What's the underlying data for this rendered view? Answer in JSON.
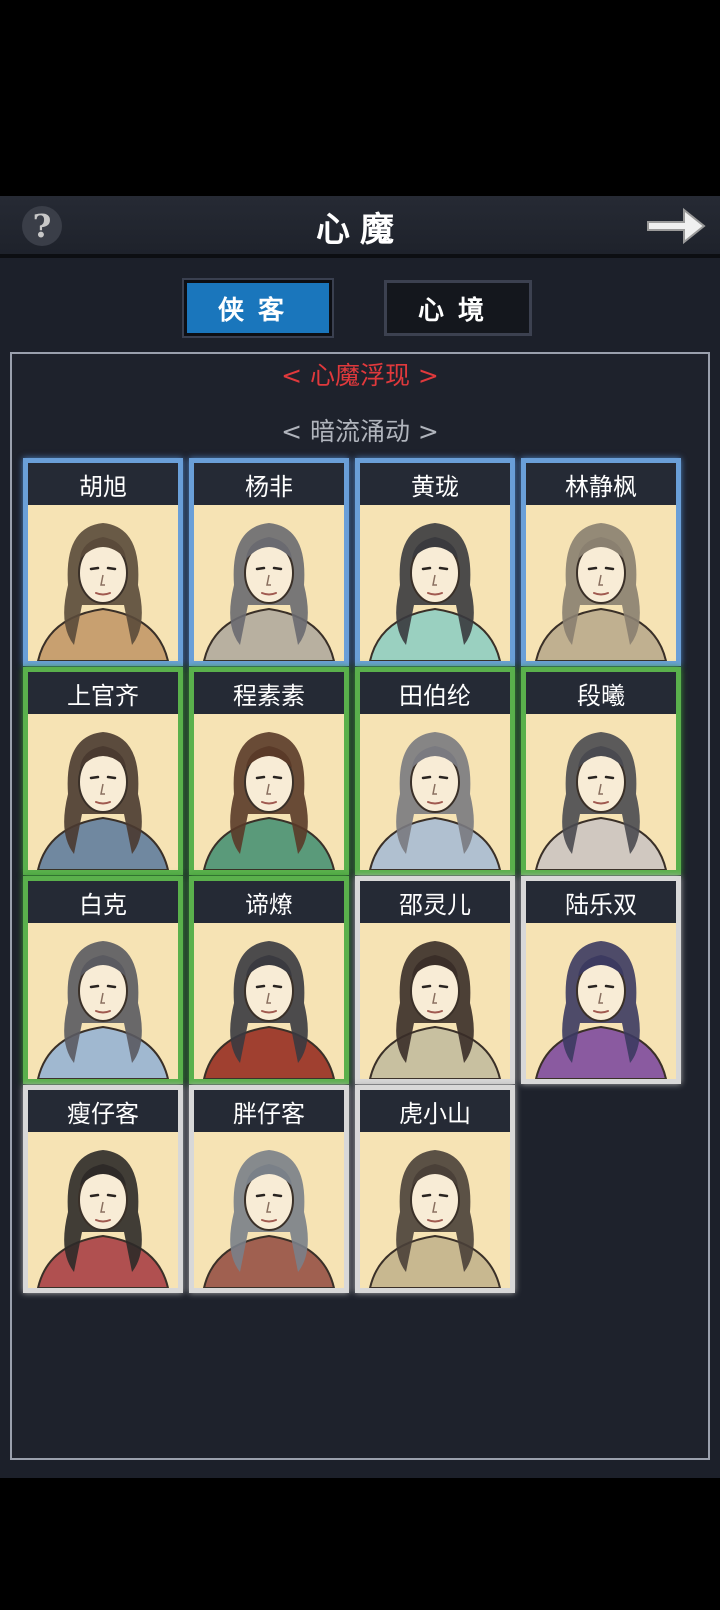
{
  "header": {
    "title": "心魔",
    "help_symbol": "?",
    "forward_icon": "arrow-right-icon"
  },
  "tabs": [
    {
      "label": "侠客",
      "active": true
    },
    {
      "label": "心境",
      "active": false
    }
  ],
  "sections": {
    "surfaced": "< 心魔浮现 >",
    "undercurrent": "< 暗流涌动 >"
  },
  "colors": {
    "accent_blue": "#1a76bc",
    "section_red": "#e0393c",
    "tier_blue": "#6a9fd8",
    "tier_green": "#5ab04c",
    "tier_white": "#d8d8d8"
  },
  "characters": [
    {
      "name": "胡旭",
      "tier": "blue"
    },
    {
      "name": "杨非",
      "tier": "blue"
    },
    {
      "name": "黄珑",
      "tier": "blue"
    },
    {
      "name": "林静枫",
      "tier": "blue"
    },
    {
      "name": "上官齐",
      "tier": "green"
    },
    {
      "name": "程素素",
      "tier": "green"
    },
    {
      "name": "田伯纶",
      "tier": "green"
    },
    {
      "name": "段曦",
      "tier": "green"
    },
    {
      "name": "白克",
      "tier": "green"
    },
    {
      "name": "谛燎",
      "tier": "green"
    },
    {
      "name": "邵灵儿",
      "tier": "white"
    },
    {
      "name": "陆乐双",
      "tier": "white"
    },
    {
      "name": "瘦仔客",
      "tier": "white"
    },
    {
      "name": "胖仔客",
      "tier": "white"
    },
    {
      "name": "虎小山",
      "tier": "white"
    }
  ]
}
